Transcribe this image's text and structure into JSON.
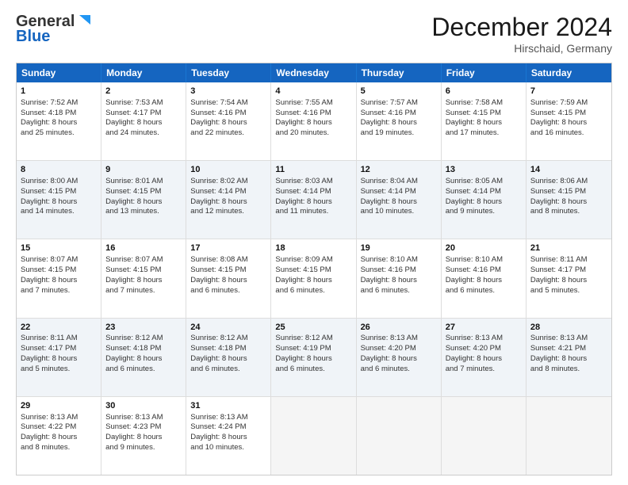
{
  "header": {
    "logo_general": "General",
    "logo_blue": "Blue",
    "title": "December 2024",
    "subtitle": "Hirschaid, Germany"
  },
  "weekdays": [
    "Sunday",
    "Monday",
    "Tuesday",
    "Wednesday",
    "Thursday",
    "Friday",
    "Saturday"
  ],
  "rows": [
    [
      {
        "day": "1",
        "line1": "Sunrise: 7:52 AM",
        "line2": "Sunset: 4:18 PM",
        "line3": "Daylight: 8 hours",
        "line4": "and 25 minutes."
      },
      {
        "day": "2",
        "line1": "Sunrise: 7:53 AM",
        "line2": "Sunset: 4:17 PM",
        "line3": "Daylight: 8 hours",
        "line4": "and 24 minutes."
      },
      {
        "day": "3",
        "line1": "Sunrise: 7:54 AM",
        "line2": "Sunset: 4:16 PM",
        "line3": "Daylight: 8 hours",
        "line4": "and 22 minutes."
      },
      {
        "day": "4",
        "line1": "Sunrise: 7:55 AM",
        "line2": "Sunset: 4:16 PM",
        "line3": "Daylight: 8 hours",
        "line4": "and 20 minutes."
      },
      {
        "day": "5",
        "line1": "Sunrise: 7:57 AM",
        "line2": "Sunset: 4:16 PM",
        "line3": "Daylight: 8 hours",
        "line4": "and 19 minutes."
      },
      {
        "day": "6",
        "line1": "Sunrise: 7:58 AM",
        "line2": "Sunset: 4:15 PM",
        "line3": "Daylight: 8 hours",
        "line4": "and 17 minutes."
      },
      {
        "day": "7",
        "line1": "Sunrise: 7:59 AM",
        "line2": "Sunset: 4:15 PM",
        "line3": "Daylight: 8 hours",
        "line4": "and 16 minutes."
      }
    ],
    [
      {
        "day": "8",
        "line1": "Sunrise: 8:00 AM",
        "line2": "Sunset: 4:15 PM",
        "line3": "Daylight: 8 hours",
        "line4": "and 14 minutes."
      },
      {
        "day": "9",
        "line1": "Sunrise: 8:01 AM",
        "line2": "Sunset: 4:15 PM",
        "line3": "Daylight: 8 hours",
        "line4": "and 13 minutes."
      },
      {
        "day": "10",
        "line1": "Sunrise: 8:02 AM",
        "line2": "Sunset: 4:14 PM",
        "line3": "Daylight: 8 hours",
        "line4": "and 12 minutes."
      },
      {
        "day": "11",
        "line1": "Sunrise: 8:03 AM",
        "line2": "Sunset: 4:14 PM",
        "line3": "Daylight: 8 hours",
        "line4": "and 11 minutes."
      },
      {
        "day": "12",
        "line1": "Sunrise: 8:04 AM",
        "line2": "Sunset: 4:14 PM",
        "line3": "Daylight: 8 hours",
        "line4": "and 10 minutes."
      },
      {
        "day": "13",
        "line1": "Sunrise: 8:05 AM",
        "line2": "Sunset: 4:14 PM",
        "line3": "Daylight: 8 hours",
        "line4": "and 9 minutes."
      },
      {
        "day": "14",
        "line1": "Sunrise: 8:06 AM",
        "line2": "Sunset: 4:15 PM",
        "line3": "Daylight: 8 hours",
        "line4": "and 8 minutes."
      }
    ],
    [
      {
        "day": "15",
        "line1": "Sunrise: 8:07 AM",
        "line2": "Sunset: 4:15 PM",
        "line3": "Daylight: 8 hours",
        "line4": "and 7 minutes."
      },
      {
        "day": "16",
        "line1": "Sunrise: 8:07 AM",
        "line2": "Sunset: 4:15 PM",
        "line3": "Daylight: 8 hours",
        "line4": "and 7 minutes."
      },
      {
        "day": "17",
        "line1": "Sunrise: 8:08 AM",
        "line2": "Sunset: 4:15 PM",
        "line3": "Daylight: 8 hours",
        "line4": "and 6 minutes."
      },
      {
        "day": "18",
        "line1": "Sunrise: 8:09 AM",
        "line2": "Sunset: 4:15 PM",
        "line3": "Daylight: 8 hours",
        "line4": "and 6 minutes."
      },
      {
        "day": "19",
        "line1": "Sunrise: 8:10 AM",
        "line2": "Sunset: 4:16 PM",
        "line3": "Daylight: 8 hours",
        "line4": "and 6 minutes."
      },
      {
        "day": "20",
        "line1": "Sunrise: 8:10 AM",
        "line2": "Sunset: 4:16 PM",
        "line3": "Daylight: 8 hours",
        "line4": "and 6 minutes."
      },
      {
        "day": "21",
        "line1": "Sunrise: 8:11 AM",
        "line2": "Sunset: 4:17 PM",
        "line3": "Daylight: 8 hours",
        "line4": "and 5 minutes."
      }
    ],
    [
      {
        "day": "22",
        "line1": "Sunrise: 8:11 AM",
        "line2": "Sunset: 4:17 PM",
        "line3": "Daylight: 8 hours",
        "line4": "and 5 minutes."
      },
      {
        "day": "23",
        "line1": "Sunrise: 8:12 AM",
        "line2": "Sunset: 4:18 PM",
        "line3": "Daylight: 8 hours",
        "line4": "and 6 minutes."
      },
      {
        "day": "24",
        "line1": "Sunrise: 8:12 AM",
        "line2": "Sunset: 4:18 PM",
        "line3": "Daylight: 8 hours",
        "line4": "and 6 minutes."
      },
      {
        "day": "25",
        "line1": "Sunrise: 8:12 AM",
        "line2": "Sunset: 4:19 PM",
        "line3": "Daylight: 8 hours",
        "line4": "and 6 minutes."
      },
      {
        "day": "26",
        "line1": "Sunrise: 8:13 AM",
        "line2": "Sunset: 4:20 PM",
        "line3": "Daylight: 8 hours",
        "line4": "and 6 minutes."
      },
      {
        "day": "27",
        "line1": "Sunrise: 8:13 AM",
        "line2": "Sunset: 4:20 PM",
        "line3": "Daylight: 8 hours",
        "line4": "and 7 minutes."
      },
      {
        "day": "28",
        "line1": "Sunrise: 8:13 AM",
        "line2": "Sunset: 4:21 PM",
        "line3": "Daylight: 8 hours",
        "line4": "and 8 minutes."
      }
    ],
    [
      {
        "day": "29",
        "line1": "Sunrise: 8:13 AM",
        "line2": "Sunset: 4:22 PM",
        "line3": "Daylight: 8 hours",
        "line4": "and 8 minutes."
      },
      {
        "day": "30",
        "line1": "Sunrise: 8:13 AM",
        "line2": "Sunset: 4:23 PM",
        "line3": "Daylight: 8 hours",
        "line4": "and 9 minutes."
      },
      {
        "day": "31",
        "line1": "Sunrise: 8:13 AM",
        "line2": "Sunset: 4:24 PM",
        "line3": "Daylight: 8 hours",
        "line4": "and 10 minutes."
      },
      {
        "day": "",
        "line1": "",
        "line2": "",
        "line3": "",
        "line4": ""
      },
      {
        "day": "",
        "line1": "",
        "line2": "",
        "line3": "",
        "line4": ""
      },
      {
        "day": "",
        "line1": "",
        "line2": "",
        "line3": "",
        "line4": ""
      },
      {
        "day": "",
        "line1": "",
        "line2": "",
        "line3": "",
        "line4": ""
      }
    ]
  ]
}
